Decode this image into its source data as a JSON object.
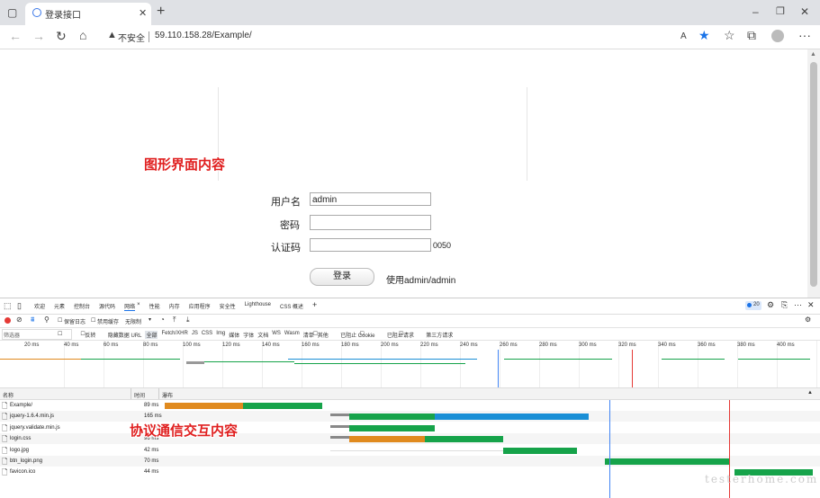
{
  "browser": {
    "tab_title": "登录接口",
    "not_secure": "不安全",
    "url": "59.110.158.28/Example/"
  },
  "page": {
    "annotation_top": "图形界面内容",
    "username_label": "用户名",
    "username_value": "admin",
    "password_label": "密码",
    "captcha_label": "认证码",
    "captcha_code": "0050",
    "login_button": "登录",
    "hint": "使用admin/admin"
  },
  "devtools": {
    "tabs": [
      "欢迎",
      "元素",
      "控制台",
      "源代码",
      "网络",
      "性能",
      "内存",
      "应用程序",
      "安全性",
      "Lighthouse",
      "CSS 概述"
    ],
    "active_tab": "网络",
    "issues_count": "20",
    "preserve_log": "保留日志",
    "disable_cache": "禁用缓存",
    "throttle": "无限制",
    "filter_placeholder": "筛选器",
    "filter_options": [
      "反转",
      "隐藏数据 URL",
      "全部",
      "Fetch/XHR",
      "JS",
      "CSS",
      "Img",
      "媒体",
      "字体",
      "文档",
      "WS",
      "Wasm",
      "清单",
      "其他",
      "已阻止 Cookie",
      "已阻止请求",
      "第三方请求"
    ],
    "timeline_ticks": [
      "20 ms",
      "40 ms",
      "60 ms",
      "80 ms",
      "100 ms",
      "120 ms",
      "140 ms",
      "160 ms",
      "180 ms",
      "200 ms",
      "220 ms",
      "240 ms",
      "260 ms",
      "280 ms",
      "300 ms",
      "320 ms",
      "340 ms",
      "360 ms",
      "380 ms",
      "400 ms"
    ],
    "col_name": "名称",
    "col_time": "时间",
    "col_waterfall": "瀑布",
    "annotation": "协议通信交互内容",
    "rows": [
      {
        "name": "Example/",
        "time": "89 ms"
      },
      {
        "name": "jquery-1.6.4.min.js",
        "time": "165 ms"
      },
      {
        "name": "jquery.validate.min.js",
        "time": "113 ms"
      },
      {
        "name": "login.css",
        "time": "96 ms"
      },
      {
        "name": "logo.jpg",
        "time": "42 ms"
      },
      {
        "name": "btn_login.png",
        "time": "70 ms"
      },
      {
        "name": "favicon.ico",
        "time": "44 ms"
      }
    ],
    "watermark": "testerhome.com"
  }
}
